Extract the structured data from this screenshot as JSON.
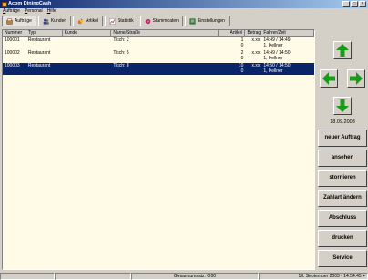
{
  "window": {
    "title": "Acom DiningCash",
    "min": "_",
    "max": "□",
    "close": "×"
  },
  "menu": [
    "Aufträge",
    "Personal",
    "Hilfe"
  ],
  "toolbar": {
    "tabs": [
      {
        "label": "Aufträge",
        "icon": "orders-icon"
      },
      {
        "label": "Kunden",
        "icon": "customers-icon"
      },
      {
        "label": "Artikel",
        "icon": "articles-icon"
      },
      {
        "label": "Statistik",
        "icon": "statistics-icon"
      },
      {
        "label": "Stammdaten",
        "icon": "master-data-icon"
      },
      {
        "label": "Einstellungen",
        "icon": "settings-icon"
      }
    ]
  },
  "table": {
    "columns": [
      "Nummer",
      "Typ",
      "Kunde",
      "Name/Straße",
      "Artikel",
      "Betrag",
      "Fahrer/Zeit"
    ],
    "rows": [
      {
        "nummer": "100001",
        "typ": "Restaurant",
        "kunde": "",
        "name": "Tisch: 2",
        "artikel": "1",
        "artikel2": "0",
        "betrag": "x.xx",
        "zeit": "14:49 / 14:49",
        "fahrer": "1, Kellner",
        "selected": false
      },
      {
        "nummer": "100002",
        "typ": "Restaurant",
        "kunde": "",
        "name": "Tisch: 5",
        "artikel": "2",
        "artikel2": "0",
        "betrag": "x.xx",
        "zeit": "14:49 / 14:50",
        "fahrer": "1, Kellner",
        "selected": false
      },
      {
        "nummer": "100003",
        "typ": "Restaurant",
        "kunde": "",
        "name": "Tisch: 8",
        "artikel": "10",
        "artikel2": "0",
        "betrag": "x.xx",
        "zeit": "14:50 / 14:50",
        "fahrer": "1, Kellner",
        "selected": true
      }
    ]
  },
  "nav": {
    "date": "18.09.2003"
  },
  "actions": [
    "neuer Auftrag",
    "ansehen",
    "stornieren",
    "Zahlart ändern",
    "Abschluss",
    "drucken",
    "Service"
  ],
  "status": {
    "total": "Gesamtumsatz: 0.00",
    "datetime": "18. September 2003 - 14:54:45 +"
  },
  "colors": {
    "selection": "#0a246a",
    "arrow": "#1a9a1a",
    "table_bg": "#fffbe6"
  }
}
